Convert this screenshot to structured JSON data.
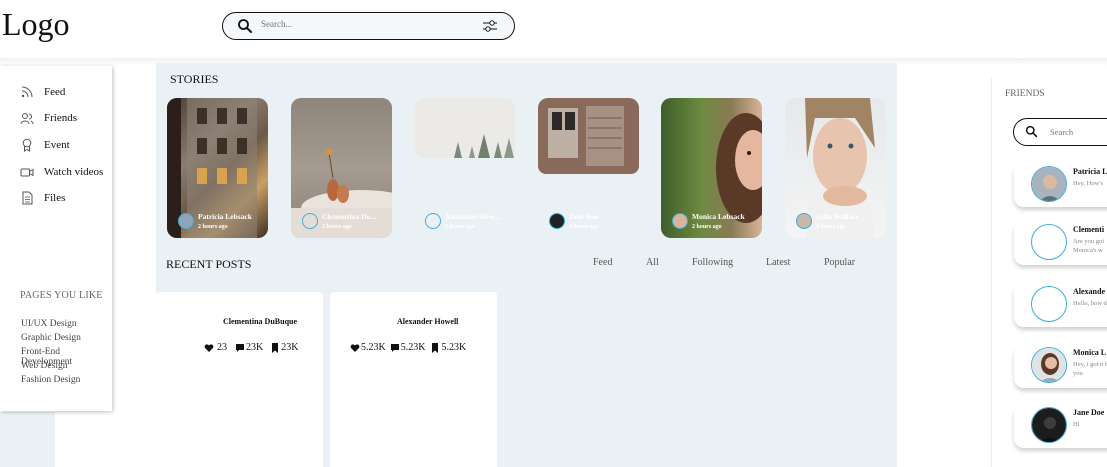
{
  "header": {
    "logo": "Logo",
    "search_placeholder": "Search..."
  },
  "sidebar": {
    "items": [
      {
        "label": "Feed",
        "icon": "rss-icon"
      },
      {
        "label": "Friends",
        "icon": "users-icon"
      },
      {
        "label": "Event",
        "icon": "award-icon"
      },
      {
        "label": "Watch videos",
        "icon": "video-icon"
      },
      {
        "label": "Files",
        "icon": "file-icon"
      }
    ],
    "pages_title": "PAGES YOU LIKE",
    "pages": [
      "UI/UX Design",
      "Graphic Design",
      "Front-End Development",
      "Web Design",
      "Fashion Design"
    ]
  },
  "stories": {
    "title": "STORIES",
    "items": [
      {
        "name": "Patricia Lebsack",
        "time": "2 hours ago"
      },
      {
        "name": "Clementina Du...",
        "time": "2 hours ago"
      },
      {
        "name": "Alexander Hew...",
        "time": "2 hours ago"
      },
      {
        "name": "Jane Doe",
        "time": "2 hours ago"
      },
      {
        "name": "Monica Lebsack",
        "time": "2 hours ago"
      },
      {
        "name": "John Wallace",
        "time": "2 hours ago"
      }
    ]
  },
  "recent_posts": {
    "title": "RECENT POSTS",
    "filters": [
      "Feed",
      "All",
      "Following",
      "Latest",
      "Popular"
    ],
    "posts": [
      {
        "author": "Clementina DuBuque",
        "likes": "23",
        "comments": "23K",
        "saves": "23K"
      },
      {
        "author": "Alexander Howell",
        "likes": "5.23K",
        "comments": "5.23K",
        "saves": "5.23K"
      }
    ]
  },
  "friends": {
    "title": "FRIENDS",
    "search_placeholder": "Search",
    "items": [
      {
        "name": "Patricia L",
        "message": "Hey, How's"
      },
      {
        "name": "Clementi",
        "message": "Are you goi Monica's w"
      },
      {
        "name": "Alexande",
        "message": "Hello, how doing?"
      },
      {
        "name": "Monica L",
        "message": "Hey, i got n for you"
      },
      {
        "name": "Jane Doe",
        "message": "Hi"
      }
    ]
  },
  "colors": {
    "accent": "#3aaed8",
    "main_background": "#eaf1f4",
    "text": "#111111"
  }
}
